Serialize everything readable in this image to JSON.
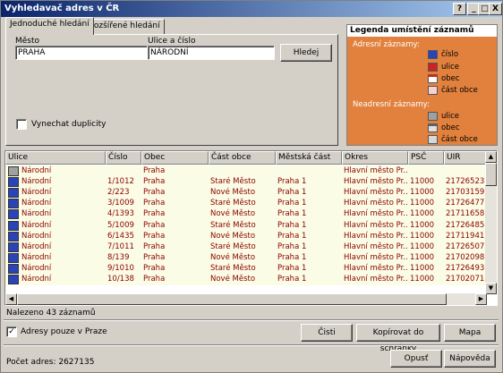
{
  "window": {
    "title": "Vyhledavač adres v ČR",
    "btn_help": "?",
    "btn_min": "_",
    "btn_max": "□",
    "btn_close": "X"
  },
  "tabs": [
    {
      "label": "Jednoduché hledání"
    },
    {
      "label": "Rozšířené hledání"
    }
  ],
  "search": {
    "city_label": "Město",
    "city_value": "PRAHA",
    "street_label": "Ulice a číslo",
    "street_value": "NÁRODNÍ",
    "search_button": "Hledej",
    "skip_duplicates_label": "Vynechat duplicity",
    "skip_duplicates_checked": false
  },
  "legend": {
    "title": "Legenda umístění záznamů",
    "address_group": "Adresní záznamy:",
    "address_items": [
      "číslo",
      "ulice",
      "obec",
      "část obce"
    ],
    "nonaddress_group": "Neadresní záznamy:",
    "nonaddress_items": [
      "ulice",
      "obec",
      "část obce"
    ]
  },
  "table": {
    "columns": [
      "Ulice",
      "Číslo",
      "Obec",
      "Část obce",
      "Městská část",
      "Okres",
      "PSČ",
      "UIR"
    ],
    "rows": [
      {
        "icon": "gray",
        "cells": [
          "Národní",
          "",
          "Praha",
          "",
          "",
          "Hlavní město Pr...",
          "",
          ""
        ]
      },
      {
        "icon": "blue",
        "cells": [
          "Národní",
          "1/1012",
          "Praha",
          "Staré Město",
          "Praha 1",
          "Hlavní město Pr...",
          "11000",
          "21726523"
        ]
      },
      {
        "icon": "blue",
        "cells": [
          "Národní",
          "2/223",
          "Praha",
          "Nové Město",
          "Praha 1",
          "Hlavní město Pr...",
          "11000",
          "21703159"
        ]
      },
      {
        "icon": "blue",
        "cells": [
          "Národní",
          "3/1009",
          "Praha",
          "Staré Město",
          "Praha 1",
          "Hlavní město Pr...",
          "11000",
          "21726477"
        ]
      },
      {
        "icon": "blue",
        "cells": [
          "Národní",
          "4/1393",
          "Praha",
          "Nové Město",
          "Praha 1",
          "Hlavní město Pr...",
          "11000",
          "21711658"
        ]
      },
      {
        "icon": "blue",
        "cells": [
          "Národní",
          "5/1009",
          "Praha",
          "Staré Město",
          "Praha 1",
          "Hlavní město Pr...",
          "11000",
          "21726485"
        ]
      },
      {
        "icon": "blue",
        "cells": [
          "Národní",
          "6/1435",
          "Praha",
          "Nové Město",
          "Praha 1",
          "Hlavní město Pr...",
          "11000",
          "21711941"
        ]
      },
      {
        "icon": "blue",
        "cells": [
          "Národní",
          "7/1011",
          "Praha",
          "Staré Město",
          "Praha 1",
          "Hlavní město Pr...",
          "11000",
          "21726507"
        ]
      },
      {
        "icon": "blue",
        "cells": [
          "Národní",
          "8/139",
          "Praha",
          "Nové Město",
          "Praha 1",
          "Hlavní město Pr...",
          "11000",
          "21702098"
        ]
      },
      {
        "icon": "blue",
        "cells": [
          "Národní",
          "9/1010",
          "Praha",
          "Staré Město",
          "Praha 1",
          "Hlavní město Pr...",
          "11000",
          "21726493"
        ]
      },
      {
        "icon": "blue",
        "cells": [
          "Národní",
          "10/138",
          "Praha",
          "Nové Město",
          "Praha 1",
          "Hlavní město Pr...",
          "11000",
          "21702071"
        ]
      }
    ]
  },
  "status": {
    "found": "Nalezeno 43 záznamů",
    "count": "Počet adres: 2627135"
  },
  "options": {
    "prague_only_label": "Adresy pouze v Praze",
    "prague_only_checked": true
  },
  "buttons": {
    "clear": "Čisti",
    "copy": "Kopírovat do schránky",
    "map": "Mapa",
    "quit": "Opusť",
    "help": "Nápověda"
  },
  "colors": {
    "legend_bg": "#e1813d",
    "row_text": "#8b0000",
    "row_bg": "#fbfce5"
  }
}
